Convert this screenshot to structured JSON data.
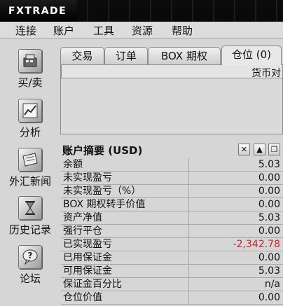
{
  "app": {
    "logo": "FXTRADE"
  },
  "menu": [
    "连接",
    "账户",
    "工具",
    "资源",
    "帮助"
  ],
  "sidebar": [
    {
      "label": "买/卖",
      "icon": "cash-register-icon"
    },
    {
      "label": "分析",
      "icon": "chart-analysis-icon"
    },
    {
      "label": "外汇新闻",
      "icon": "newspaper-icon"
    },
    {
      "label": "历史记录",
      "icon": "hourglass-icon"
    },
    {
      "label": "论坛",
      "icon": "question-bubble-icon"
    }
  ],
  "tabs": [
    {
      "label": "交易",
      "active": false
    },
    {
      "label": "订单",
      "active": false
    },
    {
      "label": "BOX 期权",
      "active": false
    },
    {
      "label": "仓位 (0)",
      "active": true
    }
  ],
  "positions": {
    "column_header": "货币对"
  },
  "summary": {
    "title": "账户摘要 (USD)",
    "controls": {
      "close": "✕",
      "up": "▲",
      "restore": "❐"
    },
    "rows": [
      {
        "label": "余额",
        "value": "5.03",
        "color": "#111111"
      },
      {
        "label": "未实现盈亏",
        "value": "0.00",
        "color": "#111111"
      },
      {
        "label": "未实现盈亏（%）",
        "value": "0.00",
        "color": "#111111"
      },
      {
        "label": "BOX 期权转手价值",
        "value": "0.00",
        "color": "#111111"
      },
      {
        "label": "资产净值",
        "value": "5.03",
        "color": "#111111"
      },
      {
        "label": "强行平仓",
        "value": "0.00",
        "color": "#111111"
      },
      {
        "label": "已实现盈亏",
        "value": "-2,342.78",
        "color": "#cc2222"
      },
      {
        "label": "已用保证金",
        "value": "0.00",
        "color": "#111111"
      },
      {
        "label": "可用保证金",
        "value": "5.03",
        "color": "#111111"
      },
      {
        "label": "保证金百分比",
        "value": "n/a",
        "color": "#111111"
      },
      {
        "label": "仓位价值",
        "value": "0.00",
        "color": "#111111"
      }
    ]
  }
}
